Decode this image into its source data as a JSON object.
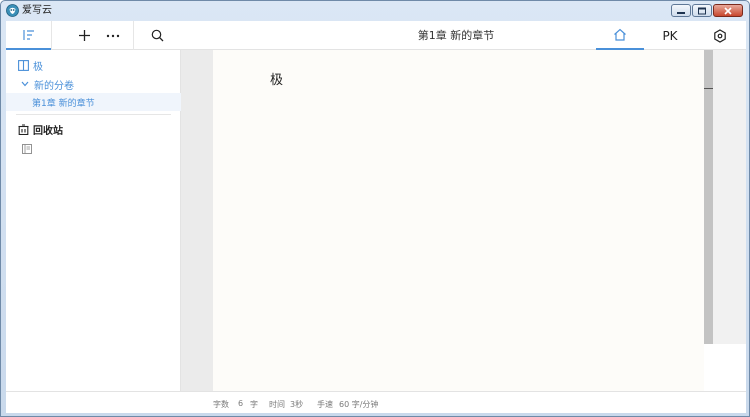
{
  "window": {
    "title": "爱写云"
  },
  "toolbar": {
    "chapter_title": "第1章  新的章节",
    "pk_label": "PK"
  },
  "sidebar": {
    "book_name": "极",
    "volume_name": "新的分卷",
    "chapter_name": "第1章   新的章节",
    "trash_label": "回收站"
  },
  "editor": {
    "content": "极"
  },
  "status": {
    "word_count_label": "字数",
    "word_count_value": "6",
    "word_count_unit": "字",
    "time_label": "时间",
    "time_value": "3秒",
    "speed_label": "手速",
    "speed_value": "60 字/分钟"
  },
  "colors": {
    "accent": "#4a90d9",
    "editor_bg": "#fdfcf9",
    "gutter": "#ebebeb"
  }
}
